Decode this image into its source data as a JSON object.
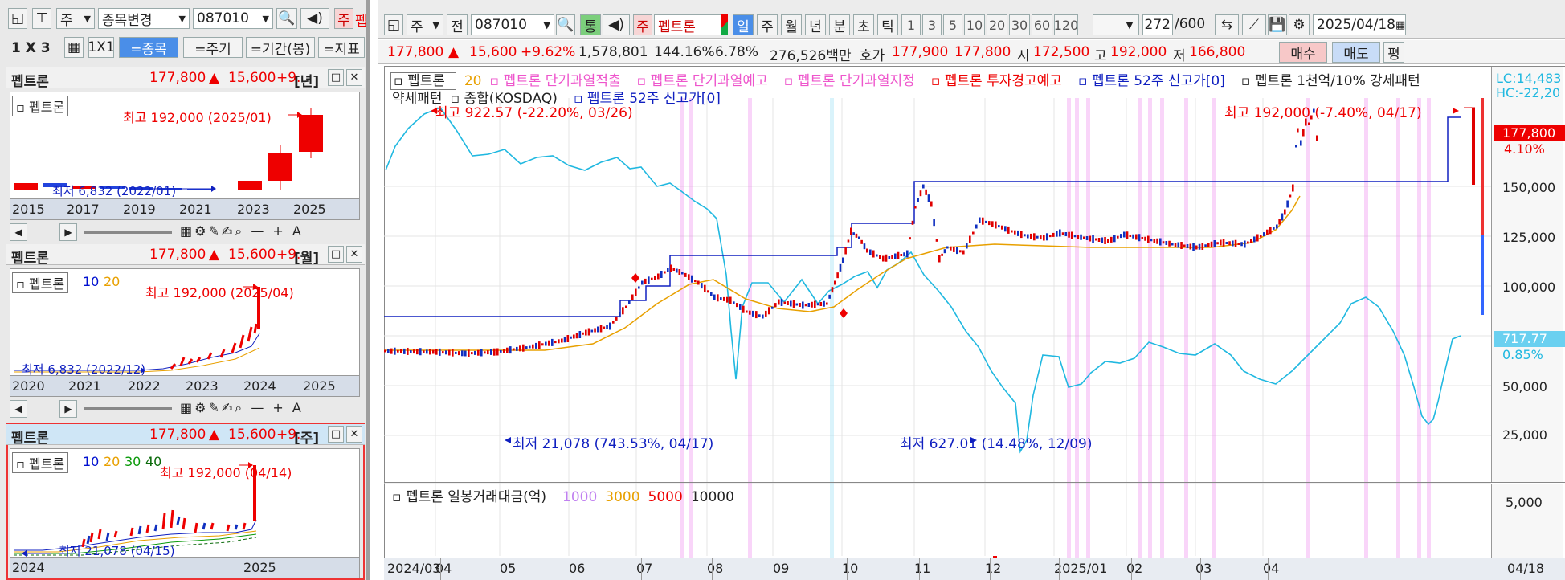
{
  "left_toolbar": {
    "mode": "주",
    "symbol_change": "종목변경",
    "code": "087010",
    "pen_label": "펩"
  },
  "left_toolbar2": {
    "layout": "1 X 3",
    "one_by_one": "1X1",
    "btn_symbol": "=종목",
    "btn_period": "=주기",
    "btn_range": "=기간(봉)",
    "btn_indicator": "=지표"
  },
  "panels": [
    {
      "name": "펩트론",
      "price": "177,800",
      "arrow": "▲",
      "change": "15,600",
      "pct": "+9.",
      "period": "[년]",
      "legend_name": "펩트론",
      "legend_ma": [],
      "high_note": "최고 192,000 (2025/01)",
      "low_note": "최저 6,832 (2022/01)",
      "axis": [
        "2015",
        "2017",
        "2019",
        "2021",
        "2023",
        "2025"
      ]
    },
    {
      "name": "펩트론",
      "price": "177,800",
      "arrow": "▲",
      "change": "15,600",
      "pct": "+9.",
      "period": "[월]",
      "legend_name": "펩트론",
      "legend_ma": [
        "10",
        "20"
      ],
      "high_note": "최고 192,000 (2025/04)",
      "low_note": "최저 6,832 (2022/12)",
      "axis": [
        "2020",
        "2021",
        "2022",
        "2023",
        "2024",
        "2025"
      ]
    },
    {
      "name": "펩트론",
      "price": "177,800",
      "arrow": "▲",
      "change": "15,600",
      "pct": "+9.",
      "period": "[주]",
      "legend_name": "펩트론",
      "legend_ma": [
        "10",
        "20",
        "30",
        "40"
      ],
      "high_note": "최고 192,000 (04/14)",
      "low_note": "최저 21,078 (04/15)",
      "axis": [
        "2024",
        "2025"
      ]
    }
  ],
  "main_toolbar": {
    "mode": "주",
    "prev": "전",
    "code": "087010",
    "tong": "통",
    "ju_box": "주",
    "name": "펩트론",
    "periods": [
      "일",
      "주",
      "월",
      "년",
      "분",
      "초",
      "틱"
    ],
    "active_period": "일",
    "numbers": [
      "1",
      "3",
      "5",
      "10",
      "20",
      "30",
      "60",
      "120"
    ],
    "count": "272",
    "count_max": "/600",
    "date": "2025/04/18"
  },
  "quote_bar": {
    "price": "177,800",
    "arrow": "▲",
    "change": "15,600",
    "pct": "+9.62%",
    "volume": "1,578,801",
    "vol_ratio": "144.16%",
    "turnover": "6.78%",
    "amount": "276,526백만",
    "hoga_label": "호가",
    "ask": "177,900",
    "bid": "177,800",
    "open_label": "시",
    "open": "172,500",
    "high_label": "고",
    "high": "192,000",
    "low_label": "저",
    "low": "166,800",
    "buy": "매수",
    "sell": "매도",
    "avg": "평"
  },
  "legend_line1": [
    "펩트론",
    "20",
    "펩트론 단기과열적출",
    "펩트론 단기과열예고",
    "펩트론 단기과열지정",
    "펩트론 투자경고예고",
    "펩트론 52주 신고가[0]",
    "펩트론 1천억/10% 강세패턴"
  ],
  "legend_line2": [
    "약세패턴",
    "종합(KOSDAQ)",
    "펩트론 52주 신고가[0]"
  ],
  "annotations": {
    "kospi_high": "최고 922.57 (-22.20%, 03/26)",
    "price_high": "최고 192,000 (-7.40%, 04/17)",
    "price_low": "최저 21,078 (743.53%, 04/17)",
    "kospi_low": "최저 627.01 (14.48%, 12/09)"
  },
  "right_axis": {
    "lc": "LC:14,483",
    "hc": "HC:-22,20",
    "price_tag": "177,800",
    "price_pct": "4.10%",
    "kospi_tag": "717.77",
    "kospi_pct": "0.85%",
    "ticks": [
      "150,000",
      "125,000",
      "100,000",
      "75,000",
      "50,000",
      "25,000"
    ],
    "vol_tick": "5,000"
  },
  "volume_legend": {
    "title": "펩트론 일봉거래대금(억)",
    "levels": [
      "1000",
      "3000",
      "5000",
      "10000"
    ]
  },
  "x_axis": [
    "2024/03",
    "04",
    "05",
    "06",
    "07",
    "08",
    "09",
    "10",
    "11",
    "12",
    "2025/01",
    "02",
    "03",
    "04",
    "04/18"
  ],
  "colors": {
    "up": "#e00000",
    "down": "#1030c0",
    "kosdaq": "#20b8e0",
    "ma20": "#e8a000",
    "marker": "#ee88ee",
    "newhigh": "#1020c0"
  }
}
